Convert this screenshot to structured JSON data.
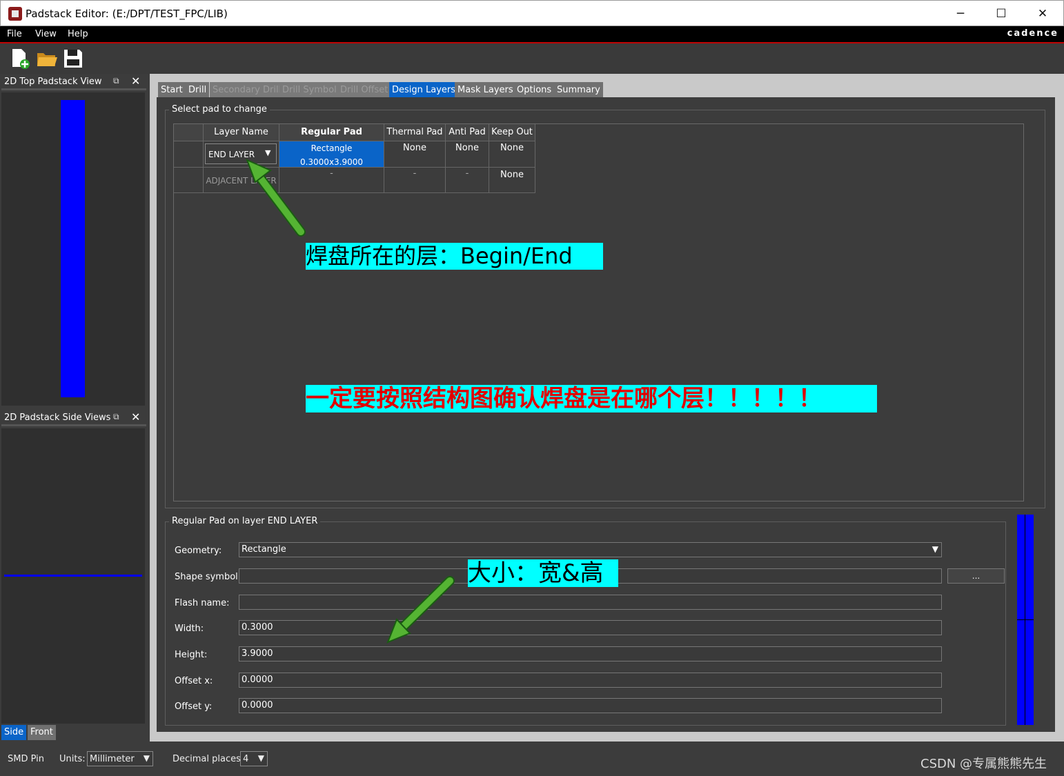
{
  "window": {
    "title": "Padstack Editor:   (E:/DPT/TEST_FPC/LIB)",
    "minimize": "─",
    "maximize": "☐",
    "close": "✕"
  },
  "menu": {
    "file": "File",
    "view": "View",
    "help": "Help",
    "brand": "cadence"
  },
  "toolbar": {
    "new_icon": "new-file-icon",
    "open_icon": "open-folder-icon",
    "save_icon": "save-icon"
  },
  "left_panels": {
    "top_view_title": "2D Top Padstack View",
    "side_view_title": "2D Padstack Side Views",
    "side_tab": "Side",
    "front_tab": "Front",
    "pad_color": "#0000ff"
  },
  "tabs": [
    "Start",
    "Drill",
    "Secondary Drill",
    "Drill Symbol",
    "Drill Offset",
    "Design Layers",
    "Mask Layers",
    "Options",
    "Summary"
  ],
  "active_tab": "Design Layers",
  "select_group": {
    "title": "Select pad to change",
    "headers": [
      "Layer Name",
      "Regular Pad",
      "Thermal Pad",
      "Anti Pad",
      "Keep Out"
    ],
    "rows": [
      {
        "layer": "END LAYER",
        "regular": "Rectangle 0.3000x3.9000",
        "thermal": "None",
        "anti": "None",
        "keep": "None"
      },
      {
        "layer": "ADJACENT LAYER",
        "regular": "-",
        "thermal": "-",
        "anti": "-",
        "keep": "None"
      }
    ]
  },
  "annotations": {
    "layer_note": "焊盘所在的层：Begin/End",
    "warning_note": "一定要按照结构图确认焊盘是在哪个层！！！！！",
    "size_note": "大小：宽&高"
  },
  "regular_group": {
    "title": "Regular Pad on layer END LAYER",
    "geometry_label": "Geometry:",
    "geometry_value": "Rectangle",
    "shape_label": "Shape symbol:",
    "shape_value": "",
    "browse_label": "...",
    "flash_label": "Flash name:",
    "flash_value": "",
    "width_label": "Width:",
    "width_value": "0.3000",
    "height_label": "Height:",
    "height_value": "3.9000",
    "offx_label": "Offset x:",
    "offx_value": "0.0000",
    "offy_label": "Offset y:",
    "offy_value": "0.0000"
  },
  "status": {
    "mode": "SMD Pin",
    "units_label": "Units:",
    "units_value": "Millimeter",
    "decimal_label": "Decimal places:",
    "decimal_value": "4",
    "watermark": "CSDN @专属熊熊先生"
  }
}
